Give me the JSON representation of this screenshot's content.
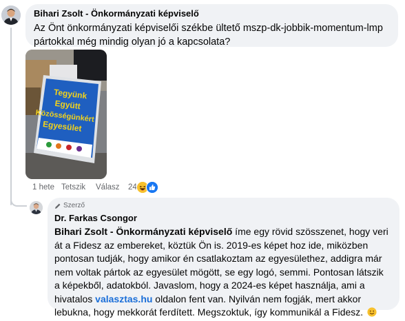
{
  "comment1": {
    "author": "Bihari Zsolt - Önkormányzati képviselő",
    "text": "Az Önt önkormányzati képviselői székbe ültető mszp-dk-jobbik-momentum-lmp pártokkal még mindig olyan jó a kapcsolata?",
    "photo": {
      "sign_lines": [
        "Tegyünk",
        "Együtt",
        "Közösségünkért",
        "Egyesület"
      ]
    },
    "meta": {
      "time": "1 hete",
      "like_label": "Tetszik",
      "reply_label": "Válasz",
      "reaction_count": "24",
      "reactions": [
        "haha-icon",
        "like-icon"
      ]
    }
  },
  "reply": {
    "badge_label": "Szerző",
    "author": "Dr. Farkas Csongor",
    "mention": "Bihari Zsolt - Önkormányzati képviselő",
    "text_before_link": " íme egy rövid szösszenet, hogy veri át a Fidesz az embereket, köztük Ön is. 2019-es képet hoz ide, miközben pontosan tudják, hogy amikor én csatlakoztam az egyesülethez, addigra már nem voltak pártok az egyesület mögött, se egy logó, semmi. Pontosan látszik a képekből, adatokból. Javaslom, hogy a 2024-es képet használja, ami a hivatalos ",
    "link": "valasztas.hu",
    "text_after_link": " oldalon fent van. Nyilván nem fogják, mert akkor lebukna, hogy mekkorát ferdített. Megszoktuk, így kommunikál a Fidesz.",
    "emoji": "smile-emoji"
  },
  "colors": {
    "bubble": "#f0f2f5",
    "link": "#1a6ed8",
    "sign_blue": "#1f5fc0",
    "sign_yellow": "#f2d21b"
  }
}
